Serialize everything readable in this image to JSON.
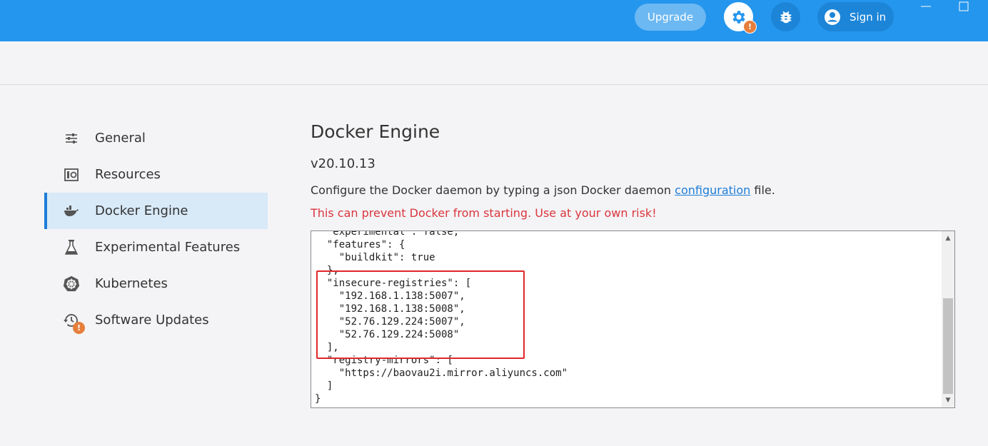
{
  "topbar": {
    "upgrade_label": "Upgrade",
    "settings_badge": "!",
    "signin_label": "Sign in",
    "accent_color": "#2496ed",
    "icons": [
      "gear-icon",
      "bug-icon",
      "user-circle-icon"
    ]
  },
  "sidebar": {
    "items": [
      {
        "label": "General",
        "icon": "sliders-icon"
      },
      {
        "label": "Resources",
        "icon": "resources-icon"
      },
      {
        "label": "Docker Engine",
        "icon": "whale-icon",
        "active": true
      },
      {
        "label": "Experimental Features",
        "icon": "flask-icon"
      },
      {
        "label": "Kubernetes",
        "icon": "helm-wheel-icon"
      },
      {
        "label": "Software Updates",
        "icon": "history-icon",
        "badge": "!"
      }
    ]
  },
  "main": {
    "title": "Docker Engine",
    "version": "v20.10.13",
    "description_prefix": "Configure the Docker daemon by typing a json Docker daemon ",
    "description_link": "configuration",
    "description_suffix": " file.",
    "warning": "This can prevent Docker from starting. Use at your own risk!",
    "warning_color": "#d9363e",
    "editor_text": "  \"experimental\": false,\n  \"features\": {\n    \"buildkit\": true\n  },\n  \"insecure-registries\": [\n    \"192.168.1.138:5007\",\n    \"192.168.1.138:5008\",\n    \"52.76.129.224:5007\",\n    \"52.76.129.224:5008\"\n  ],\n  \"registry-mirrors\": [\n    \"https://baovau2i.mirror.aliyuncs.com\"\n  ]\n}"
  }
}
